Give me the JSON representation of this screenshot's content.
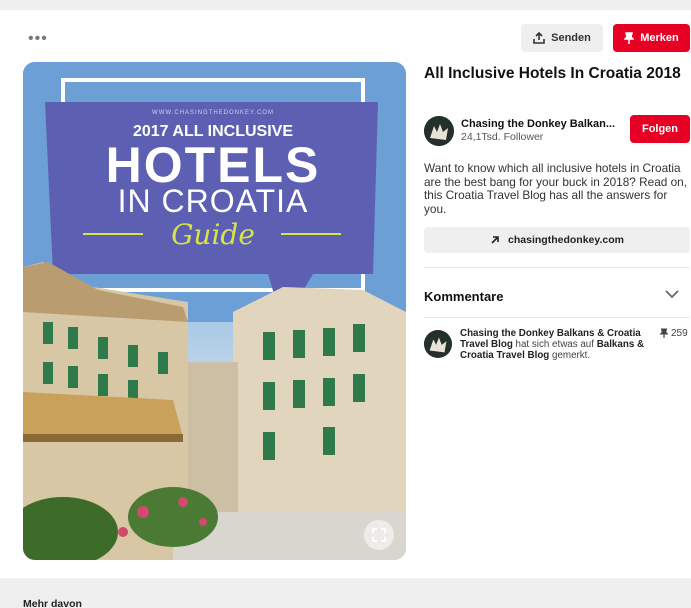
{
  "toolbar": {
    "more_icon": "more-horizontal-icon",
    "send_label": "Senden",
    "save_label": "Merken"
  },
  "image": {
    "website": "WWW.CHASINGTHEDONKEY.COM",
    "headline_year": "2017 ALL INCLUSIVE",
    "headline_main": "HOTELS",
    "headline_sub": "IN CROATIA",
    "headline_guide": "Guide",
    "expand_icon": "expand-icon"
  },
  "pin": {
    "title": "All Inclusive Hotels In Croatia 2018",
    "description": "Want to know which all inclusive hotels in Croatia are the best bang for your buck in 2018? Read on, this Croatia Travel Blog has all the answers for you.",
    "link_label": "chasingthedonkey.com"
  },
  "author": {
    "name": "Chasing the Donkey Balkan...",
    "followers": "24,1Tsd. Follower",
    "follow_label": "Folgen"
  },
  "comments": {
    "heading": "Kommentare",
    "activity": {
      "user": "Chasing the Donkey Balkans & Croatia Travel Blog",
      "middle": " hat sich etwas auf ",
      "board": "Balkans & Croatia Travel Blog",
      "end": " gemerkt.",
      "repin_count": "259"
    }
  },
  "footer": {
    "more_label": "Mehr davon"
  },
  "colors": {
    "accent": "#e60023",
    "button_grey": "#efefef"
  }
}
